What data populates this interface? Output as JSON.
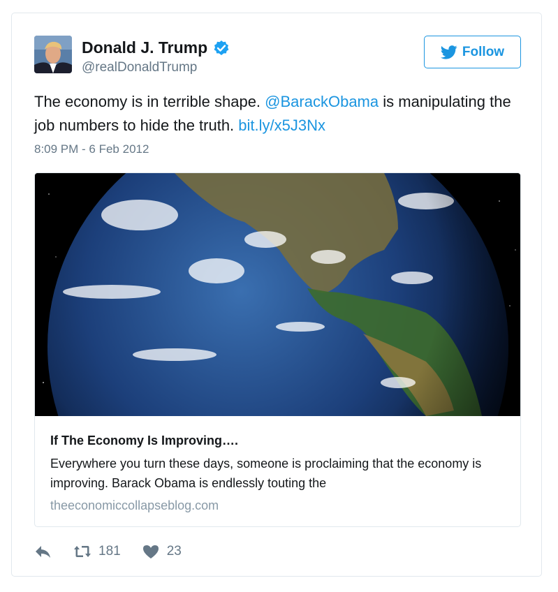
{
  "author": {
    "name": "Donald J. Trump",
    "handle": "@realDonaldTrump",
    "verified": true
  },
  "follow_label": "Follow",
  "tweet": {
    "text_before": "The economy is in terrible shape. ",
    "mention": "@BarackObama",
    "text_middle": " is manipulating the job numbers to hide the truth. ",
    "link": "bit.ly/x5J3Nx",
    "timestamp": "8:09 PM - 6 Feb 2012"
  },
  "card": {
    "title": "If The Economy Is Improving….",
    "description": "Everywhere you turn these days, someone is proclaiming that the economy is improving.  Barack Obama is endlessly touting the",
    "domain": "theeconomiccollapseblog.com"
  },
  "actions": {
    "retweets": "181",
    "likes": "23"
  },
  "colors": {
    "accent": "#1b95e0",
    "secondary_text": "#657786"
  },
  "icons": [
    "verified-badge-icon",
    "twitter-bird-icon",
    "reply-icon",
    "retweet-icon",
    "heart-icon"
  ]
}
